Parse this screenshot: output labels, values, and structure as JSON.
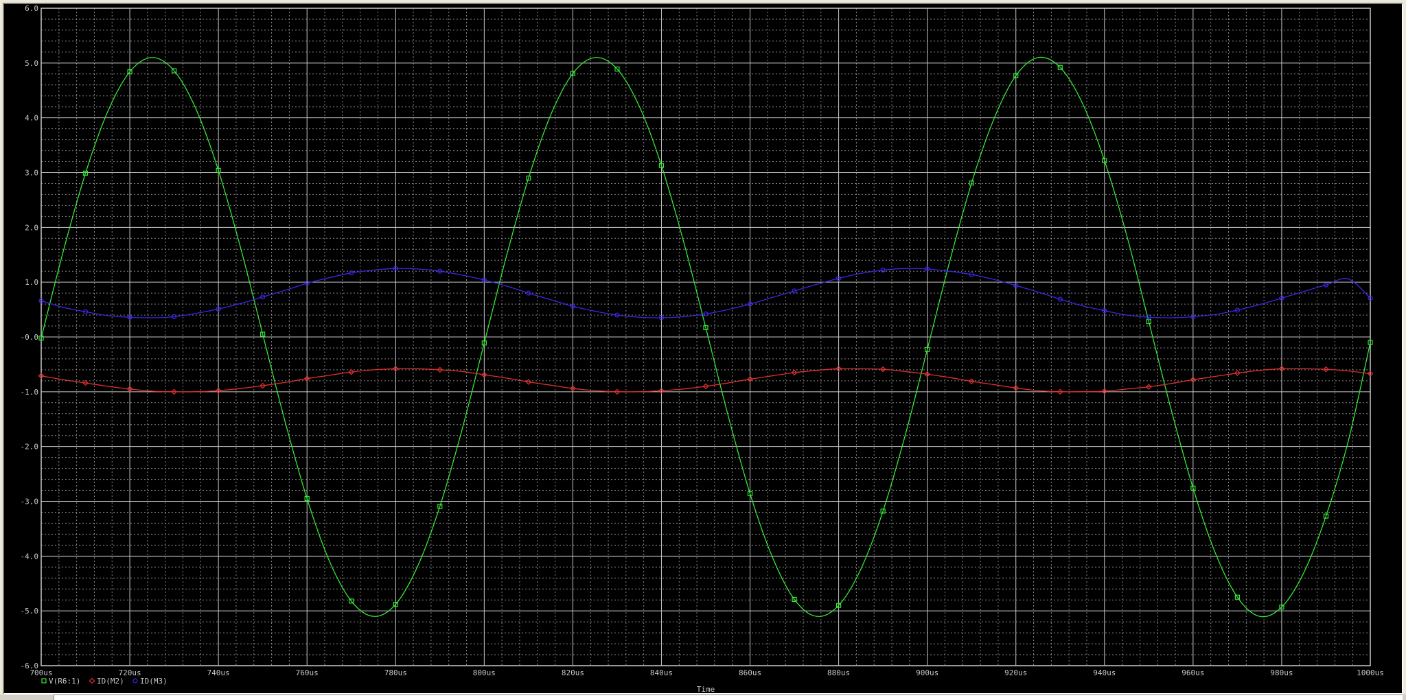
{
  "colors": {
    "background": "#000000",
    "grid_major": "#c8c8c8",
    "grid_minor": "#b4b4b4",
    "axis_text": "#c8c8c8",
    "series_green": "#37e637",
    "series_red": "#e03030",
    "series_blue": "#3c28e6"
  },
  "chart_data": {
    "type": "line",
    "title": "",
    "xlabel": "Time",
    "ylabel": "",
    "x_unit": "us",
    "xlim": [
      700,
      1000
    ],
    "ylim": [
      -6,
      6
    ],
    "grid": true,
    "legend_placement": "bottom-left",
    "x_ticks": [
      "700us",
      "720us",
      "740us",
      "760us",
      "780us",
      "800us",
      "820us",
      "840us",
      "860us",
      "880us",
      "900us",
      "920us",
      "940us",
      "960us",
      "980us",
      "1000us"
    ],
    "y_ticks": [
      "6.0",
      "5.0",
      "4.0",
      "3.0",
      "2.0",
      "1.0",
      "-0.0",
      "-1.0",
      "-2.0",
      "-3.0",
      "-4.0",
      "-5.0",
      "-6.0"
    ],
    "series": [
      {
        "name": "V(R6:1)",
        "marker": "square",
        "color": "#37e637",
        "x": [
          700,
          705,
          710,
          715,
          720,
          725,
          730,
          735,
          740,
          745,
          750,
          755,
          760,
          765,
          770,
          775,
          780,
          785,
          790,
          795,
          800,
          805,
          810,
          815,
          820,
          825,
          830,
          835,
          840,
          845,
          850,
          855,
          860,
          865,
          870,
          875,
          880,
          885,
          890,
          895,
          900,
          905,
          910,
          915,
          920,
          925,
          930,
          935,
          940,
          945,
          950,
          955,
          960,
          965,
          970,
          975,
          980,
          985,
          990,
          995,
          1000
        ],
        "values": [
          -0.02,
          1.57,
          2.99,
          4.11,
          4.84,
          5.1,
          4.86,
          4.15,
          3.04,
          1.63,
          0.05,
          -1.53,
          -2.95,
          -4.08,
          -4.82,
          -5.1,
          -4.88,
          -4.18,
          -3.09,
          -1.69,
          -0.11,
          1.47,
          2.9,
          4.05,
          4.81,
          5.1,
          4.89,
          4.21,
          3.13,
          1.74,
          0.17,
          -1.42,
          -2.86,
          -4.01,
          -4.79,
          -5.1,
          -4.9,
          -4.24,
          -3.18,
          -1.8,
          -0.23,
          1.36,
          2.81,
          3.97,
          4.77,
          5.1,
          4.92,
          4.27,
          3.22,
          1.86,
          0.28,
          -1.31,
          -2.76,
          -3.94,
          -4.75,
          -5.1,
          -4.93,
          -4.3,
          -3.27,
          -1.91,
          -0.1
        ]
      },
      {
        "name": "ID(M2)",
        "marker": "diamond",
        "color": "#e03030",
        "x": [
          700,
          705,
          710,
          715,
          720,
          725,
          730,
          735,
          740,
          745,
          750,
          755,
          760,
          765,
          770,
          775,
          780,
          785,
          790,
          795,
          800,
          805,
          810,
          815,
          820,
          825,
          830,
          835,
          840,
          845,
          850,
          855,
          860,
          865,
          870,
          875,
          880,
          885,
          890,
          895,
          900,
          905,
          910,
          915,
          920,
          925,
          930,
          935,
          940,
          945,
          950,
          955,
          960,
          965,
          970,
          975,
          980,
          985,
          990,
          995,
          1000
        ],
        "values": [
          -0.71,
          -0.78,
          -0.84,
          -0.9,
          -0.95,
          -0.99,
          -1.0,
          -1.0,
          -0.98,
          -0.94,
          -0.89,
          -0.83,
          -0.76,
          -0.7,
          -0.64,
          -0.6,
          -0.58,
          -0.58,
          -0.6,
          -0.63,
          -0.69,
          -0.75,
          -0.82,
          -0.88,
          -0.94,
          -0.98,
          -1.0,
          -1.0,
          -0.98,
          -0.95,
          -0.9,
          -0.84,
          -0.77,
          -0.71,
          -0.65,
          -0.61,
          -0.58,
          -0.58,
          -0.59,
          -0.63,
          -0.68,
          -0.74,
          -0.81,
          -0.87,
          -0.93,
          -0.98,
          -1.0,
          -1.0,
          -0.99,
          -0.95,
          -0.91,
          -0.85,
          -0.78,
          -0.72,
          -0.66,
          -0.61,
          -0.58,
          -0.58,
          -0.59,
          -0.62,
          -0.67
        ]
      },
      {
        "name": "ID(M3)",
        "marker": "circle",
        "color": "#3c28e6",
        "x": [
          700,
          705,
          710,
          715,
          720,
          725,
          730,
          735,
          740,
          745,
          750,
          755,
          760,
          765,
          770,
          775,
          780,
          785,
          790,
          795,
          800,
          805,
          810,
          815,
          820,
          825,
          830,
          835,
          840,
          845,
          850,
          855,
          860,
          865,
          870,
          875,
          880,
          885,
          890,
          895,
          900,
          905,
          910,
          915,
          920,
          925,
          930,
          935,
          940,
          945,
          950,
          955,
          960,
          965,
          970,
          975,
          980,
          985,
          990,
          995,
          1000
        ],
        "values": [
          0.66,
          0.54,
          0.46,
          0.39,
          0.36,
          0.35,
          0.37,
          0.43,
          0.51,
          0.61,
          0.73,
          0.85,
          0.98,
          1.08,
          1.17,
          1.22,
          1.25,
          1.24,
          1.2,
          1.13,
          1.04,
          0.93,
          0.8,
          0.68,
          0.56,
          0.47,
          0.4,
          0.36,
          0.35,
          0.37,
          0.42,
          0.5,
          0.6,
          0.72,
          0.84,
          0.96,
          1.07,
          1.16,
          1.22,
          1.25,
          1.24,
          1.2,
          1.14,
          1.05,
          0.94,
          0.82,
          0.69,
          0.57,
          0.48,
          0.4,
          0.36,
          0.35,
          0.37,
          0.41,
          0.49,
          0.59,
          0.71,
          0.83,
          0.95,
          1.06,
          0.71
        ]
      }
    ]
  }
}
